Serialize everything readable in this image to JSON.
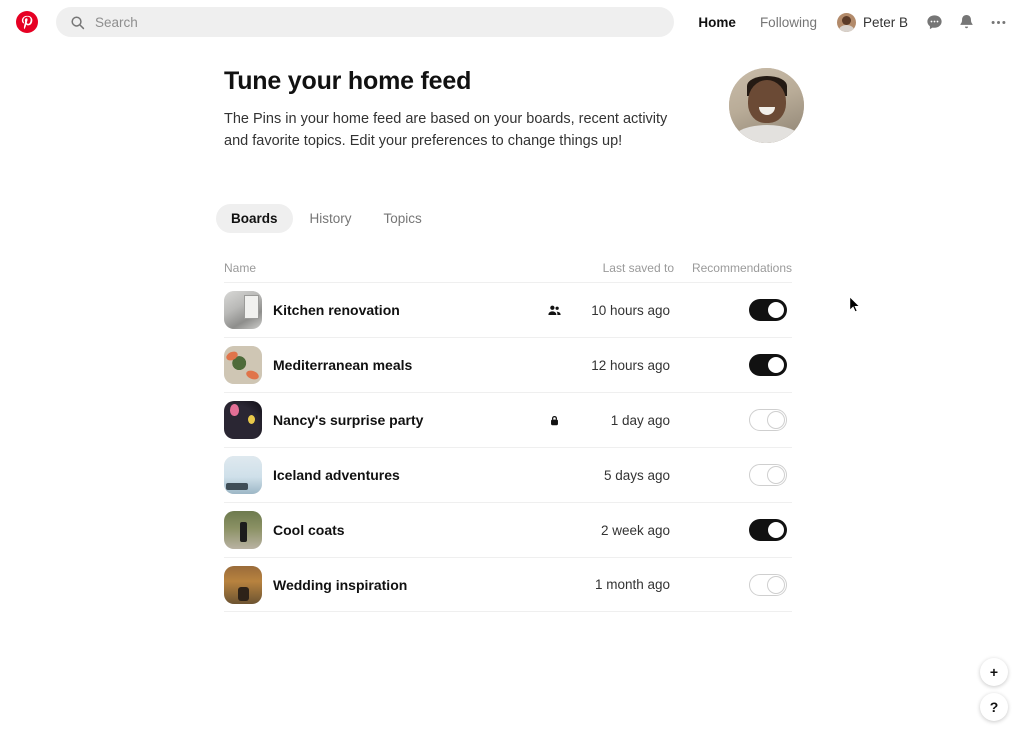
{
  "topbar": {
    "logo": "pinterest-logo",
    "search": {
      "placeholder": "Search",
      "value": ""
    },
    "nav": [
      {
        "label": "Home",
        "active": true
      },
      {
        "label": "Following",
        "active": false
      }
    ],
    "account": {
      "name": "Peter B"
    },
    "icons": [
      "messages-icon",
      "notifications-icon",
      "more-options-icon"
    ]
  },
  "hero": {
    "title": "Tune your home feed",
    "subtitle": "The Pins in your home feed are based on your boards, recent activity and favorite topics. Edit your preferences to change things up!"
  },
  "tabs": [
    {
      "label": "Boards",
      "active": true
    },
    {
      "label": "History",
      "active": false
    },
    {
      "label": "Topics",
      "active": false
    }
  ],
  "table": {
    "headers": {
      "name": "Name",
      "last_saved": "Last saved to",
      "recommendations": "Recommendations"
    },
    "rows": [
      {
        "name": "Kitchen renovation",
        "privacy": "group-icon",
        "last_saved": "10 hours ago",
        "toggle": "on",
        "thumb": "art-kitchen"
      },
      {
        "name": "Mediterranean meals",
        "privacy": "",
        "last_saved": "12 hours ago",
        "toggle": "on",
        "thumb": "art-food"
      },
      {
        "name": "Nancy's surprise party",
        "privacy": "lock-icon",
        "last_saved": "1 day ago",
        "toggle": "off",
        "thumb": "art-party"
      },
      {
        "name": "Iceland adventures",
        "privacy": "",
        "last_saved": "5 days ago",
        "toggle": "off",
        "thumb": "art-iceland"
      },
      {
        "name": "Cool coats",
        "privacy": "",
        "last_saved": "2 week ago",
        "toggle": "on",
        "thumb": "art-coats"
      },
      {
        "name": "Wedding inspiration",
        "privacy": "",
        "last_saved": "1 month ago",
        "toggle": "off",
        "thumb": "art-wedding"
      }
    ]
  },
  "fabs": [
    {
      "label": "+",
      "name": "create-button"
    },
    {
      "label": "?",
      "name": "help-button"
    }
  ],
  "colors": {
    "brand_red": "#e60023",
    "toggle_on": "#111111",
    "toggle_off_border": "#cfcfcf",
    "muted_text": "#767676",
    "search_bg": "#efefef"
  }
}
